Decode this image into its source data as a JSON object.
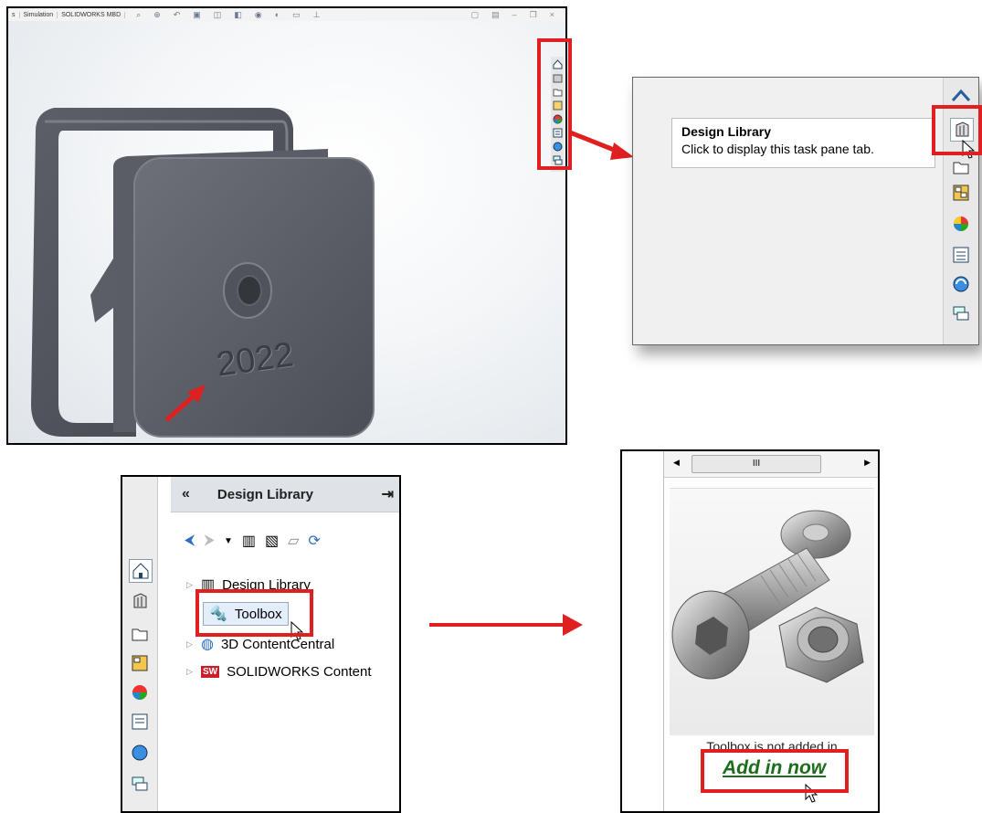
{
  "panel1": {
    "tabs": [
      "s",
      "Simulation",
      "SOLIDWORKS MBD"
    ],
    "part_text": "2022",
    "taskpane_icons": [
      "home-icon",
      "design-library-icon",
      "file-explorer-icon",
      "view-palette-icon",
      "appearances-icon",
      "custom-properties-icon",
      "solidworks-resources-icon",
      "forum-icon"
    ]
  },
  "panel2": {
    "tooltip_title": "Design Library",
    "tooltip_text": "Click to display this task pane tab."
  },
  "panel3": {
    "header_title": "Design Library",
    "tree": [
      {
        "label": "Design Library",
        "icon": "design-library-icon"
      },
      {
        "label": "Toolbox",
        "icon": "toolbox-bolt-icon"
      },
      {
        "label": "3D ContentCentral",
        "icon": "globe-icon"
      },
      {
        "label": "SOLIDWORKS Content",
        "icon": "sw-content-icon"
      }
    ]
  },
  "panel4": {
    "scroll_thumb": "III",
    "message": "Toolbox is not added in",
    "link": "Add in now"
  },
  "colors": {
    "highlight": "#e02020",
    "link": "#1b6e1b"
  }
}
